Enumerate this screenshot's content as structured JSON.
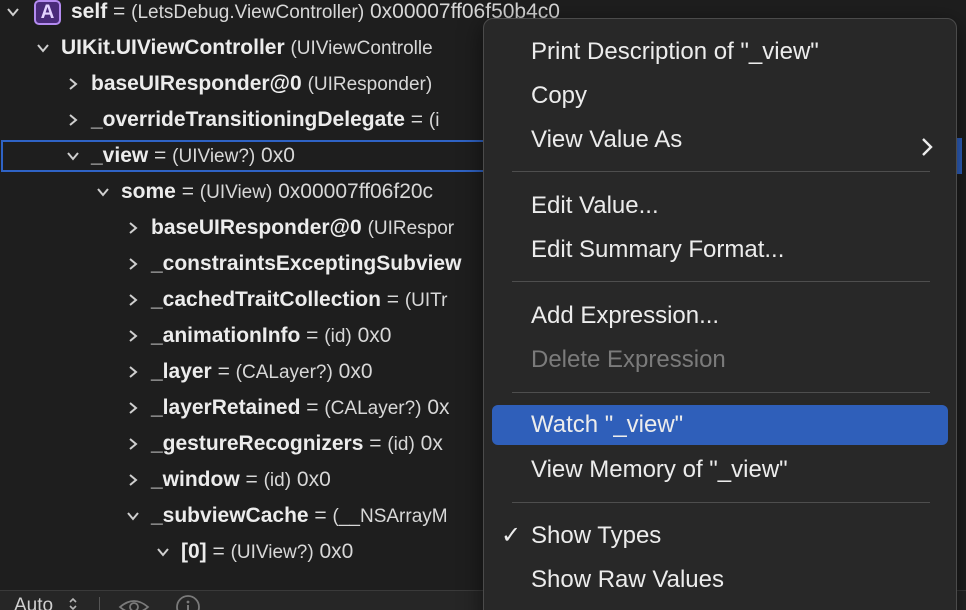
{
  "tree": {
    "rows": [
      {
        "expanded": true,
        "has_badge": true,
        "name": "self",
        "eq": " = ",
        "type": "(LetsDebug.ViewController)",
        "value": " 0x00007ff06f50b4c0"
      },
      {
        "expanded": true,
        "has_badge": false,
        "name": "UIKit.UIViewController",
        "eq": " ",
        "type": "(UIViewControlle",
        "value": ""
      },
      {
        "expanded": false,
        "has_badge": false,
        "name": "baseUIResponder@0",
        "eq": " ",
        "type": "(UIResponder)",
        "value": ""
      },
      {
        "expanded": false,
        "has_badge": false,
        "name": "_overrideTransitioningDelegate",
        "eq": " = ",
        "type": "(i",
        "value": ""
      },
      {
        "expanded": true,
        "has_badge": false,
        "name": "_view",
        "eq": " = ",
        "type": "(UIView?)",
        "value": " 0x0"
      },
      {
        "expanded": true,
        "has_badge": false,
        "name": "some",
        "eq": " = ",
        "type": "(UIView)",
        "value": " 0x00007ff06f20c"
      },
      {
        "expanded": false,
        "has_badge": false,
        "name": "baseUIResponder@0",
        "eq": " ",
        "type": "(UIRespor",
        "value": ""
      },
      {
        "expanded": false,
        "has_badge": false,
        "name": "_constraintsExceptingSubview",
        "eq": "",
        "type": "",
        "value": ""
      },
      {
        "expanded": false,
        "has_badge": false,
        "name": "_cachedTraitCollection",
        "eq": " = ",
        "type": "(UITr",
        "value": ""
      },
      {
        "expanded": false,
        "has_badge": false,
        "name": "_animationInfo",
        "eq": " = ",
        "type": "(id)",
        "value": " 0x0"
      },
      {
        "expanded": false,
        "has_badge": false,
        "name": "_layer",
        "eq": " = ",
        "type": "(CALayer?)",
        "value": " 0x0"
      },
      {
        "expanded": false,
        "has_badge": false,
        "name": "_layerRetained",
        "eq": " = ",
        "type": "(CALayer?)",
        "value": " 0x"
      },
      {
        "expanded": false,
        "has_badge": false,
        "name": "_gestureRecognizers",
        "eq": " = ",
        "type": "(id)",
        "value": " 0x"
      },
      {
        "expanded": false,
        "has_badge": false,
        "name": "_window",
        "eq": " = ",
        "type": "(id)",
        "value": " 0x0"
      },
      {
        "expanded": true,
        "has_badge": false,
        "name": "_subviewCache",
        "eq": " = ",
        "type": "(__NSArrayM",
        "value": ""
      },
      {
        "expanded": true,
        "has_badge": false,
        "name": "[0]",
        "eq": " = ",
        "type": "(UIView?)",
        "value": " 0x0"
      }
    ],
    "badge_letter": "A",
    "selected_row_index": 4
  },
  "bottom_bar": {
    "scope_label": "Auto",
    "updown_icon": "chevron-up-down-icon",
    "eye_icon": "eye-icon",
    "info_icon": "info-icon"
  },
  "context_menu": {
    "items": [
      {
        "label": "Print Description of \"_view\"",
        "disabled": false,
        "highlighted": false,
        "checked": false,
        "submenu": false
      },
      {
        "label": "Copy",
        "disabled": false,
        "highlighted": false,
        "checked": false,
        "submenu": false
      },
      {
        "label": "View Value As",
        "disabled": false,
        "highlighted": false,
        "checked": false,
        "submenu": true
      },
      {
        "separator": true
      },
      {
        "label": "Edit Value...",
        "disabled": false,
        "highlighted": false,
        "checked": false,
        "submenu": false
      },
      {
        "label": "Edit Summary Format...",
        "disabled": false,
        "highlighted": false,
        "checked": false,
        "submenu": false
      },
      {
        "separator": true
      },
      {
        "label": "Add Expression...",
        "disabled": false,
        "highlighted": false,
        "checked": false,
        "submenu": false
      },
      {
        "label": "Delete Expression",
        "disabled": true,
        "highlighted": false,
        "checked": false,
        "submenu": false
      },
      {
        "separator": true
      },
      {
        "label": "Watch \"_view\"",
        "disabled": false,
        "highlighted": true,
        "checked": false,
        "submenu": false
      },
      {
        "label": "View Memory of \"_view\"",
        "disabled": false,
        "highlighted": false,
        "checked": false,
        "submenu": false
      },
      {
        "separator": true
      },
      {
        "label": "Show Types",
        "disabled": false,
        "highlighted": false,
        "checked": true,
        "submenu": false
      },
      {
        "label": "Show Raw Values",
        "disabled": false,
        "highlighted": false,
        "checked": false,
        "submenu": false
      }
    ],
    "check_glyph": "✓",
    "highlight_color": "#2f5fba"
  }
}
